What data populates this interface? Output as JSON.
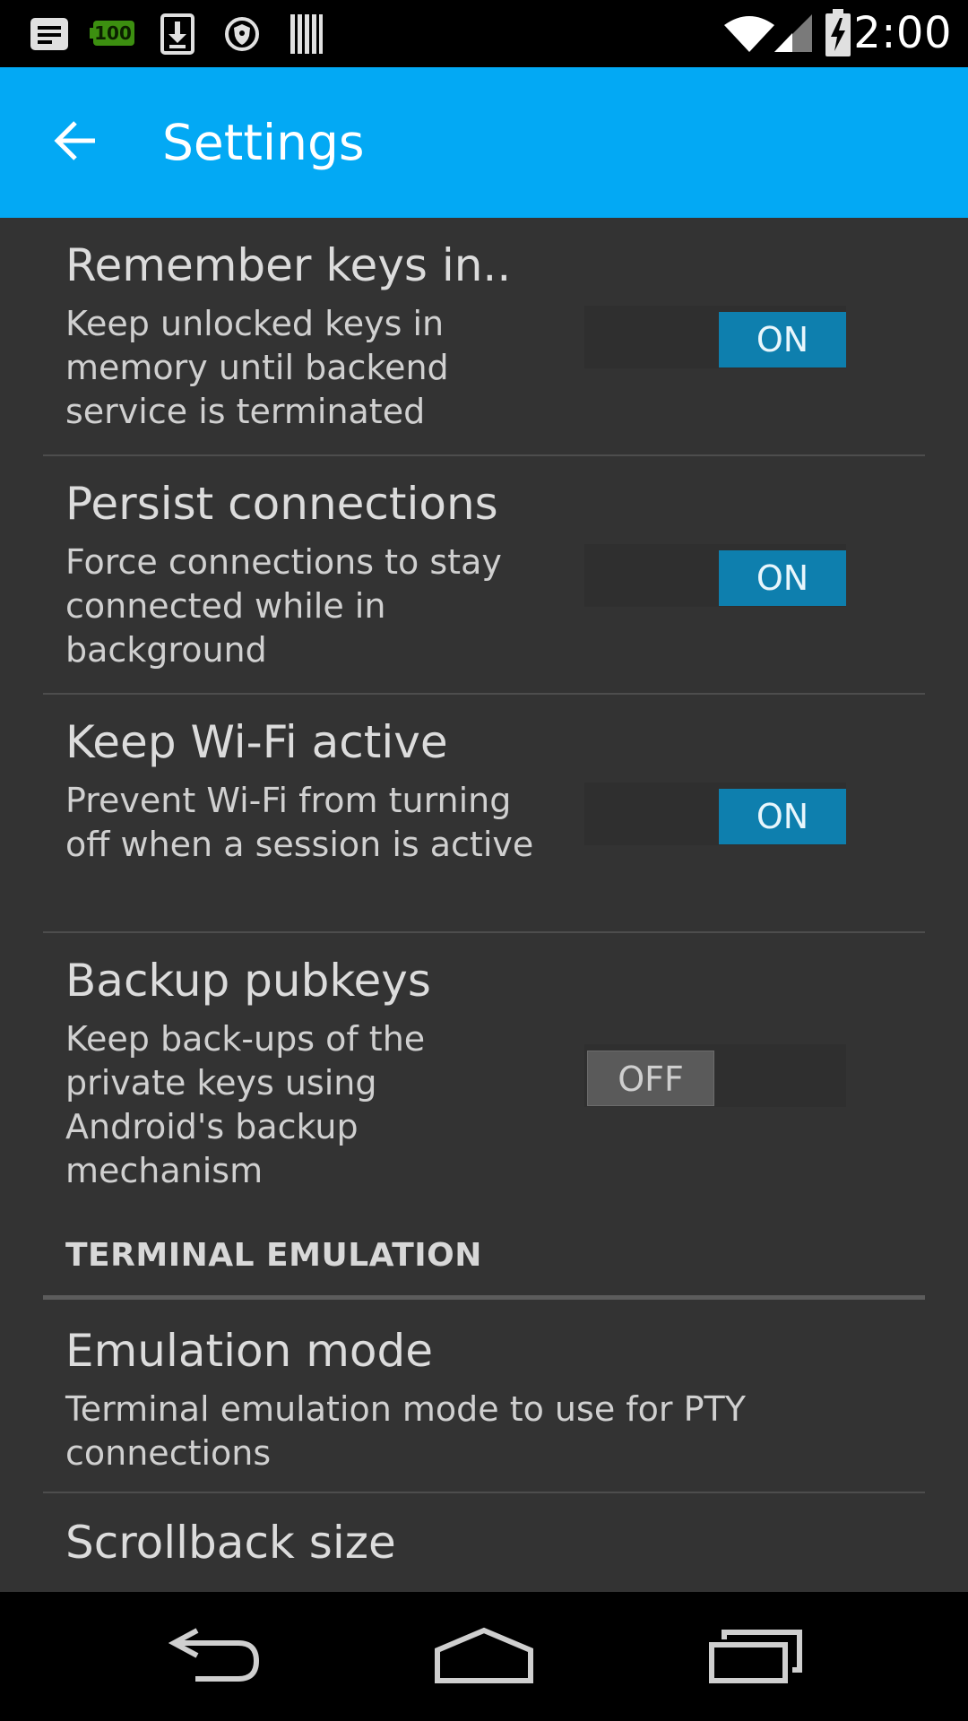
{
  "status_bar": {
    "time": "2:00",
    "battery_badge": "100",
    "icons": [
      "notes-icon",
      "battery-badge-icon",
      "download-icon",
      "shield-icon",
      "barcode-icon",
      "wifi-icon",
      "signal-icon",
      "battery-charging-icon"
    ]
  },
  "app_bar": {
    "title": "Settings",
    "back_icon": "back-arrow-icon",
    "color": "#03a9f4"
  },
  "preferences": [
    {
      "title": "Remember keys in..",
      "summary": "Keep unlocked keys in memory until backend service is terminated",
      "switch": "ON"
    },
    {
      "title": "Persist connections",
      "summary": "Force connections to stay connected while in background",
      "switch": "ON"
    },
    {
      "title": "Keep Wi-Fi active",
      "summary": "Prevent Wi-Fi from turning off when a session is active",
      "switch": "ON"
    },
    {
      "title": "Backup pubkeys",
      "summary": "Keep back-ups of the private keys using Android's backup mechanism",
      "switch": "OFF"
    }
  ],
  "category": {
    "label": "TERMINAL EMULATION"
  },
  "terminal_prefs": [
    {
      "title": "Emulation mode",
      "summary": "Terminal emulation mode to use for PTY connections"
    },
    {
      "title": "Scrollback size"
    }
  ],
  "nav_bar": {
    "icons": [
      "nav-back-icon",
      "nav-home-icon",
      "nav-recents-icon"
    ]
  }
}
